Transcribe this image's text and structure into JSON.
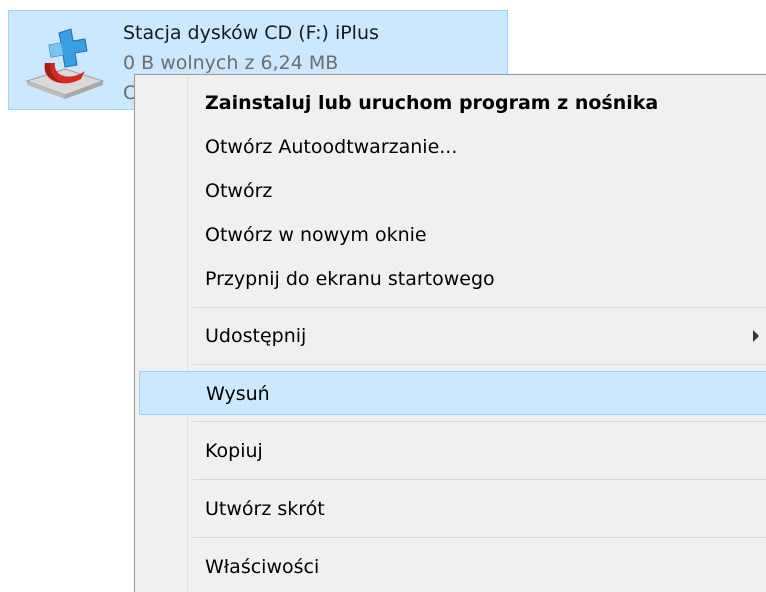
{
  "drive": {
    "title": "Stacja dysków CD (F:) iPlus",
    "free_space": "0 B wolnych z 6,24 MB",
    "filesystem": "CDFS",
    "icon": "cd-drive-autorun-icon"
  },
  "context_menu": {
    "items": [
      {
        "label": "Zainstaluj lub uruchom program z nośnika"
      },
      {
        "label": "Otwórz Autoodtwarzanie..."
      },
      {
        "label": "Otwórz"
      },
      {
        "label": "Otwórz w nowym oknie"
      },
      {
        "label": "Przypnij do ekranu startowego"
      },
      {
        "label": "Udostępnij"
      },
      {
        "label": "Wysuń"
      },
      {
        "label": "Kopiuj"
      },
      {
        "label": "Utwórz skrót"
      },
      {
        "label": "Właściwości"
      }
    ],
    "highlighted_item": "Wysuń",
    "submenu_icon": "chevron-right-icon"
  },
  "colors": {
    "selection_fill": "#cce8ff",
    "selection_border": "#99d1ff",
    "menu_background": "#f0f0f0"
  }
}
